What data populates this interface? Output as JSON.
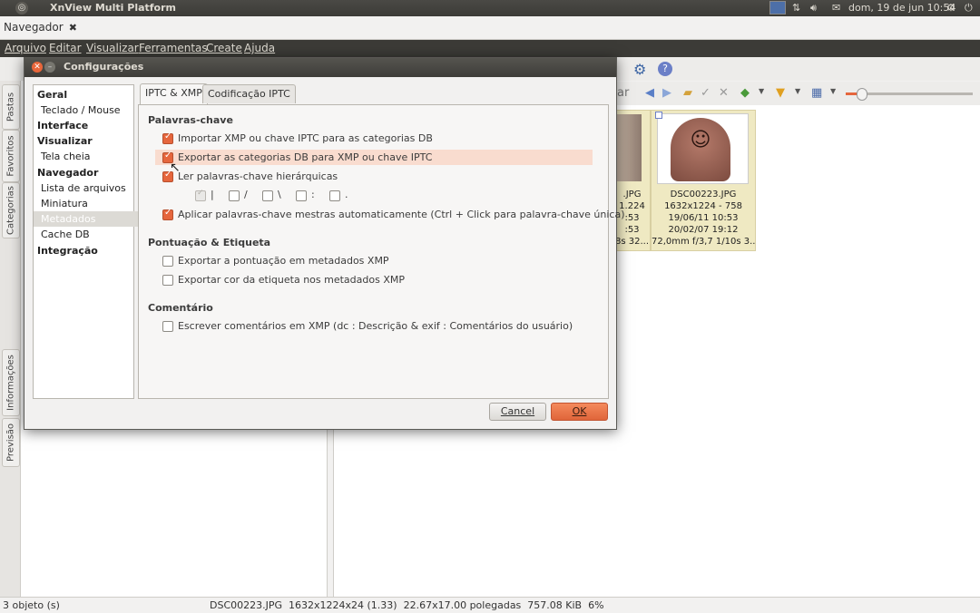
{
  "system_panel": {
    "app_title": "XnView Multi Platform",
    "datetime": "dom, 19 de jun 10:54"
  },
  "app": {
    "tab_label": "Navegador",
    "menu": [
      "Arquivo",
      "Editar",
      "Visualizar",
      "Ferramentas",
      "Create",
      "Ajuda"
    ],
    "side_tabs": [
      "Pastas",
      "Favoritos",
      "Categorias",
      "Informações",
      "Previsão"
    ],
    "search_fragment": "ar"
  },
  "thumbnails": [
    {
      "name": "JPG",
      "lines": [
        ".JPG",
        "1.224",
        ":53",
        ":53",
        "8s 32..."
      ]
    },
    {
      "name": "DSC00223.JPG",
      "lines": [
        "DSC00223.JPG",
        "1632x1224 - 758",
        "19/06/11 10:53",
        "20/02/07 19:12",
        "72,0mm f/3,7 1/10s 3..."
      ]
    }
  ],
  "status": {
    "count": "3 objeto (s)",
    "file_info": "DSC00223.JPG  1632x1224x24 (1.33)  22.67x17.00 polegadas  757.08 KiB  6%"
  },
  "dialog": {
    "title": "Configurações",
    "categories": [
      {
        "label": "Geral",
        "kind": "head"
      },
      {
        "label": "Teclado / Mouse",
        "kind": "sub"
      },
      {
        "label": "Interface",
        "kind": "head"
      },
      {
        "label": "Visualizar",
        "kind": "head"
      },
      {
        "label": "Tela cheia",
        "kind": "sub"
      },
      {
        "label": "Navegador",
        "kind": "head"
      },
      {
        "label": "Lista de arquivos",
        "kind": "sub"
      },
      {
        "label": "Miniatura",
        "kind": "sub"
      },
      {
        "label": "Metadados",
        "kind": "sub",
        "selected": true
      },
      {
        "label": "Cache DB",
        "kind": "sub"
      },
      {
        "label": "Integração",
        "kind": "head"
      }
    ],
    "tabs": [
      "IPTC & XMP",
      "Codificação IPTC"
    ],
    "sections": {
      "keywords": "Palavras-chave",
      "rating": "Pontuação & Etiqueta",
      "comment": "Comentário"
    },
    "options": {
      "import_xmp": {
        "label": "Importar XMP ou chave IPTC para as categorias DB",
        "checked": true
      },
      "export_cat": {
        "label": "Exportar as categorias DB para XMP ou chave IPTC",
        "checked": true
      },
      "read_hier": {
        "label": "Ler palavras-chave hierárquicas",
        "checked": true
      },
      "separators": [
        "|",
        "/",
        "\\",
        ":",
        "."
      ],
      "apply_master": {
        "label": "Aplicar palavras-chave mestras automaticamente (Ctrl + Click para palavra-chave única)",
        "checked": true
      },
      "export_rating": {
        "label": "Exportar a pontuação em metadados XMP",
        "checked": false
      },
      "export_color": {
        "label": "Exportar cor da etiqueta nos metadados XMP",
        "checked": false
      },
      "write_comment": {
        "label": "Escrever comentários em XMP (dc : Descrição & exif : Comentários do usuário)",
        "checked": false
      }
    },
    "buttons": {
      "cancel": "Cancel",
      "ok": "OK"
    }
  },
  "colors": {
    "accent": "#e5663d",
    "highlight": "#f9dccf",
    "thumb_bg": "#efe9c2"
  }
}
